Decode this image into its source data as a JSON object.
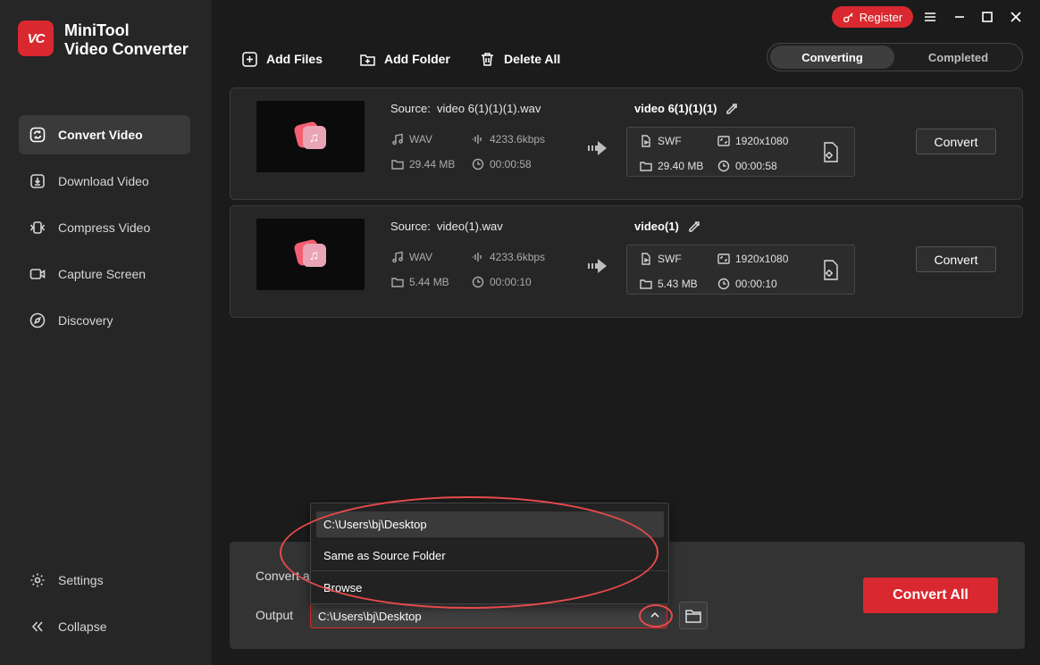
{
  "app": {
    "logo_text": "VC",
    "brand_line1": "MiniTool",
    "brand_line2": "Video Converter",
    "accent_color": "#d9282f"
  },
  "sidebar": {
    "items": [
      {
        "label": "Convert Video",
        "icon": "convert-icon",
        "active": true
      },
      {
        "label": "Download Video",
        "icon": "download-icon"
      },
      {
        "label": "Compress Video",
        "icon": "compress-icon"
      },
      {
        "label": "Capture Screen",
        "icon": "camera-icon"
      },
      {
        "label": "Discovery",
        "icon": "compass-icon"
      }
    ],
    "settings_label": "Settings",
    "collapse_label": "Collapse"
  },
  "titlebar": {
    "register_label": "Register"
  },
  "toolbar": {
    "add_files": "Add Files",
    "add_folder": "Add Folder",
    "delete_all": "Delete All"
  },
  "tabs": {
    "converting": "Converting",
    "completed": "Completed"
  },
  "files": [
    {
      "source_label": "Source:",
      "source_name": "video 6(1)(1)(1).wav",
      "src_format": "WAV",
      "src_bitrate": "4233.6kbps",
      "src_size": "29.44 MB",
      "src_duration": "00:00:58",
      "out_name": "video 6(1)(1)(1)",
      "out_format": "SWF",
      "out_resolution": "1920x1080",
      "out_size": "29.40 MB",
      "out_duration": "00:00:58",
      "convert_label": "Convert"
    },
    {
      "source_label": "Source:",
      "source_name": "video(1).wav",
      "src_format": "WAV",
      "src_bitrate": "4233.6kbps",
      "src_size": "5.44 MB",
      "src_duration": "00:00:10",
      "out_name": "video(1)",
      "out_format": "SWF",
      "out_resolution": "1920x1080",
      "out_size": "5.43 MB",
      "out_duration": "00:00:10",
      "convert_label": "Convert"
    }
  ],
  "bottom": {
    "convert_all_label_partial": "Convert al",
    "output_label": "Output",
    "output_value": "C:\\Users\\bj\\Desktop",
    "convert_all_button": "Convert All"
  },
  "dropdown": {
    "options": [
      "C:\\Users\\bj\\Desktop",
      "Same as Source Folder",
      "Browse"
    ]
  }
}
